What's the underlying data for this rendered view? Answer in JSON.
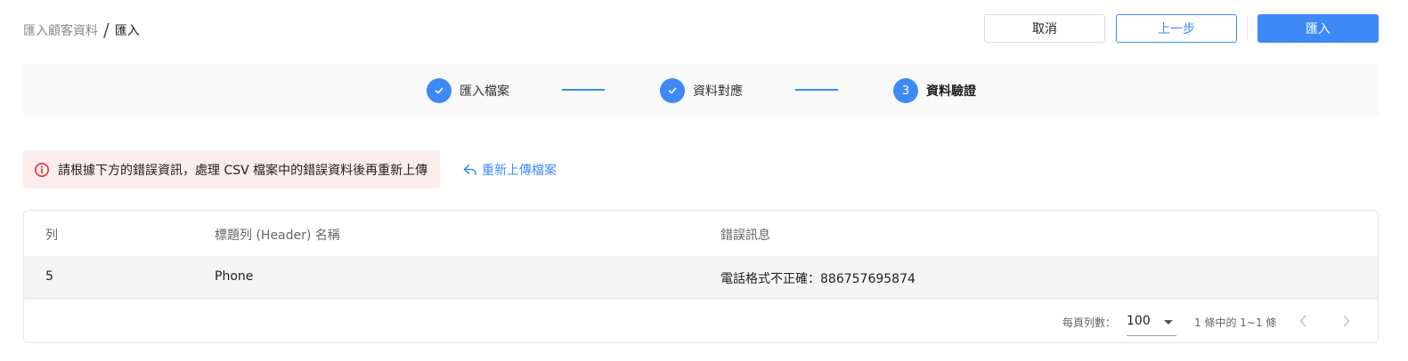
{
  "breadcrumb": {
    "parent": "匯入顧客資料",
    "separator": "/",
    "current": "匯入"
  },
  "toolbar": {
    "cancel_label": "取消",
    "back_label": "上一步",
    "import_label": "匯入"
  },
  "steps": [
    {
      "number": "1",
      "label": "匯入檔案",
      "state": "done"
    },
    {
      "number": "2",
      "label": "資料對應",
      "state": "done"
    },
    {
      "number": "3",
      "label": "資料驗證",
      "state": "active"
    }
  ],
  "alert": {
    "message": "請根據下方的錯誤資訊，處理 CSV 檔案中的錯誤資料後再重新上傳"
  },
  "reupload_label": "重新上傳檔案",
  "table": {
    "headers": [
      "列",
      "標題列 (Header) 名稱",
      "錯誤訊息"
    ],
    "rows": [
      [
        "5",
        "Phone",
        "電話格式不正確：886757695874"
      ]
    ]
  },
  "pagination": {
    "rows_per_page_label": "每頁列數：",
    "rows_per_page_value": "100",
    "range_text": "1 條中的 1~1 條"
  },
  "colors": {
    "accent": "#3d8af7",
    "alert_bg": "#fdecec",
    "alert_icon": "#e0303b"
  }
}
